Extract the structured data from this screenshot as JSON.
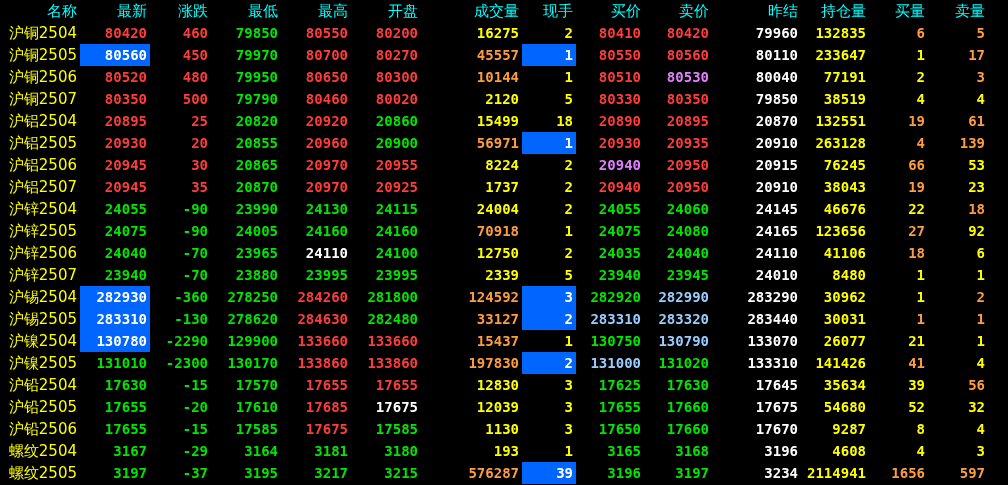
{
  "columns": [
    "名称",
    "最新",
    "涨跌",
    "最低",
    "最高",
    "开盘",
    "成交量",
    "现手",
    "买价",
    "卖价",
    "昨结",
    "持仓量",
    "买量",
    "卖量"
  ],
  "rows": [
    {
      "name": "沪铜2504",
      "cells": [
        {
          "text": "80420",
          "color": "#ff3c3c",
          "highlighted": false
        },
        {
          "text": "460",
          "color": "#ff3c3c"
        },
        {
          "text": "79850",
          "color": "#00e600"
        },
        {
          "text": "80550",
          "color": "#ff3c3c"
        },
        {
          "text": "80200",
          "color": "#ff3c3c"
        },
        {
          "text": "16275",
          "color": "#ffff00"
        },
        {
          "text": "2",
          "color": "#ffff00",
          "highlighted": false
        },
        {
          "text": "80410",
          "color": "#ff3c3c"
        },
        {
          "text": "80420",
          "color": "#ff3c3c"
        },
        {
          "text": "79960",
          "color": "#ffffff"
        },
        {
          "text": "132835",
          "color": "#ffff00"
        },
        {
          "text": "6",
          "color": "#ff9c40"
        },
        {
          "text": "5",
          "color": "#ff9c40"
        }
      ]
    },
    {
      "name": "沪铜2505",
      "cells": [
        {
          "text": "80560",
          "color": "#ffffff",
          "highlighted": true
        },
        {
          "text": "450",
          "color": "#ff3c3c"
        },
        {
          "text": "79970",
          "color": "#00e600"
        },
        {
          "text": "80700",
          "color": "#ff3c3c"
        },
        {
          "text": "80270",
          "color": "#ff3c3c"
        },
        {
          "text": "45557",
          "color": "#ff9c40"
        },
        {
          "text": "1",
          "color": "#ffffff",
          "highlighted": true
        },
        {
          "text": "80550",
          "color": "#ff3c3c"
        },
        {
          "text": "80560",
          "color": "#ff3c3c"
        },
        {
          "text": "80110",
          "color": "#ffffff"
        },
        {
          "text": "233647",
          "color": "#ffff00"
        },
        {
          "text": "1",
          "color": "#ffff00"
        },
        {
          "text": "17",
          "color": "#ff9c40"
        }
      ]
    },
    {
      "name": "沪铜2506",
      "cells": [
        {
          "text": "80520",
          "color": "#ff3c3c",
          "highlighted": false
        },
        {
          "text": "480",
          "color": "#ff3c3c"
        },
        {
          "text": "79950",
          "color": "#00e600"
        },
        {
          "text": "80650",
          "color": "#ff3c3c"
        },
        {
          "text": "80300",
          "color": "#ff3c3c"
        },
        {
          "text": "10144",
          "color": "#ff9c40"
        },
        {
          "text": "1",
          "color": "#ffff00",
          "highlighted": false
        },
        {
          "text": "80510",
          "color": "#ff3c3c"
        },
        {
          "text": "80530",
          "color": "#e080ff"
        },
        {
          "text": "80040",
          "color": "#ffffff"
        },
        {
          "text": "77191",
          "color": "#ffff00"
        },
        {
          "text": "2",
          "color": "#ffff00"
        },
        {
          "text": "3",
          "color": "#ff9c40"
        }
      ]
    },
    {
      "name": "沪铜2507",
      "cells": [
        {
          "text": "80350",
          "color": "#ff3c3c",
          "highlighted": false
        },
        {
          "text": "500",
          "color": "#ff3c3c"
        },
        {
          "text": "79790",
          "color": "#00e600"
        },
        {
          "text": "80460",
          "color": "#ff3c3c"
        },
        {
          "text": "80020",
          "color": "#ff3c3c"
        },
        {
          "text": "2120",
          "color": "#ffff00"
        },
        {
          "text": "5",
          "color": "#ffff00",
          "highlighted": false
        },
        {
          "text": "80330",
          "color": "#ff3c3c"
        },
        {
          "text": "80350",
          "color": "#ff3c3c"
        },
        {
          "text": "79850",
          "color": "#ffffff"
        },
        {
          "text": "38519",
          "color": "#ffff00"
        },
        {
          "text": "4",
          "color": "#ffff00"
        },
        {
          "text": "4",
          "color": "#ffff00"
        }
      ]
    },
    {
      "name": "沪铝2504",
      "cells": [
        {
          "text": "20895",
          "color": "#ff3c3c",
          "highlighted": false
        },
        {
          "text": "25",
          "color": "#ff3c3c"
        },
        {
          "text": "20820",
          "color": "#00e600"
        },
        {
          "text": "20920",
          "color": "#ff3c3c"
        },
        {
          "text": "20860",
          "color": "#00e600"
        },
        {
          "text": "15499",
          "color": "#ffff00"
        },
        {
          "text": "18",
          "color": "#ffff00",
          "highlighted": false
        },
        {
          "text": "20890",
          "color": "#ff3c3c"
        },
        {
          "text": "20895",
          "color": "#ff3c3c"
        },
        {
          "text": "20870",
          "color": "#ffffff"
        },
        {
          "text": "132551",
          "color": "#ffff00"
        },
        {
          "text": "19",
          "color": "#ff9c40"
        },
        {
          "text": "61",
          "color": "#ff9c40"
        }
      ]
    },
    {
      "name": "沪铝2505",
      "cells": [
        {
          "text": "20930",
          "color": "#ff3c3c",
          "highlighted": false
        },
        {
          "text": "20",
          "color": "#ff3c3c"
        },
        {
          "text": "20855",
          "color": "#00e600"
        },
        {
          "text": "20960",
          "color": "#ff3c3c"
        },
        {
          "text": "20900",
          "color": "#00e600"
        },
        {
          "text": "56971",
          "color": "#ff9c40"
        },
        {
          "text": "1",
          "color": "#ffffff",
          "highlighted": true
        },
        {
          "text": "20930",
          "color": "#ff3c3c"
        },
        {
          "text": "20935",
          "color": "#ff3c3c"
        },
        {
          "text": "20910",
          "color": "#ffffff"
        },
        {
          "text": "263128",
          "color": "#ffff00"
        },
        {
          "text": "4",
          "color": "#ff9c40"
        },
        {
          "text": "139",
          "color": "#ff9c40"
        }
      ]
    },
    {
      "name": "沪铝2506",
      "cells": [
        {
          "text": "20945",
          "color": "#ff3c3c",
          "highlighted": false
        },
        {
          "text": "30",
          "color": "#ff3c3c"
        },
        {
          "text": "20865",
          "color": "#00e600"
        },
        {
          "text": "20970",
          "color": "#ff3c3c"
        },
        {
          "text": "20955",
          "color": "#ff3c3c"
        },
        {
          "text": "8224",
          "color": "#ffff00"
        },
        {
          "text": "2",
          "color": "#ffff00",
          "highlighted": false
        },
        {
          "text": "20940",
          "color": "#e080ff"
        },
        {
          "text": "20950",
          "color": "#ff3c3c"
        },
        {
          "text": "20915",
          "color": "#ffffff"
        },
        {
          "text": "76245",
          "color": "#ffff00"
        },
        {
          "text": "66",
          "color": "#ff9c40"
        },
        {
          "text": "53",
          "color": "#ffff00"
        }
      ]
    },
    {
      "name": "沪铝2507",
      "cells": [
        {
          "text": "20945",
          "color": "#ff3c3c",
          "highlighted": false
        },
        {
          "text": "35",
          "color": "#ff3c3c"
        },
        {
          "text": "20870",
          "color": "#00e600"
        },
        {
          "text": "20970",
          "color": "#ff3c3c"
        },
        {
          "text": "20925",
          "color": "#ff3c3c"
        },
        {
          "text": "1737",
          "color": "#ffff00"
        },
        {
          "text": "2",
          "color": "#ffff00",
          "highlighted": false
        },
        {
          "text": "20940",
          "color": "#ff3c3c"
        },
        {
          "text": "20950",
          "color": "#ff3c3c"
        },
        {
          "text": "20910",
          "color": "#ffffff"
        },
        {
          "text": "38043",
          "color": "#ffff00"
        },
        {
          "text": "19",
          "color": "#ff9c40"
        },
        {
          "text": "23",
          "color": "#ffff00"
        }
      ]
    },
    {
      "name": "沪锌2504",
      "cells": [
        {
          "text": "24055",
          "color": "#00e600",
          "highlighted": false
        },
        {
          "text": "-90",
          "color": "#00e600"
        },
        {
          "text": "23990",
          "color": "#00e600"
        },
        {
          "text": "24130",
          "color": "#00e600"
        },
        {
          "text": "24115",
          "color": "#00e600"
        },
        {
          "text": "24004",
          "color": "#ffff00"
        },
        {
          "text": "2",
          "color": "#ffff00",
          "highlighted": false
        },
        {
          "text": "24055",
          "color": "#00e600"
        },
        {
          "text": "24060",
          "color": "#00e600"
        },
        {
          "text": "24145",
          "color": "#ffffff"
        },
        {
          "text": "46676",
          "color": "#ffff00"
        },
        {
          "text": "22",
          "color": "#ffff00"
        },
        {
          "text": "18",
          "color": "#ff9c40"
        }
      ]
    },
    {
      "name": "沪锌2505",
      "cells": [
        {
          "text": "24075",
          "color": "#00e600",
          "highlighted": false
        },
        {
          "text": "-90",
          "color": "#00e600"
        },
        {
          "text": "24005",
          "color": "#00e600"
        },
        {
          "text": "24160",
          "color": "#00e600"
        },
        {
          "text": "24160",
          "color": "#00e600"
        },
        {
          "text": "70918",
          "color": "#ff9c40"
        },
        {
          "text": "1",
          "color": "#ffff00",
          "highlighted": false
        },
        {
          "text": "24075",
          "color": "#00e600"
        },
        {
          "text": "24080",
          "color": "#00e600"
        },
        {
          "text": "24165",
          "color": "#ffffff"
        },
        {
          "text": "123656",
          "color": "#ffff00"
        },
        {
          "text": "27",
          "color": "#ff9c40"
        },
        {
          "text": "92",
          "color": "#ffff00"
        }
      ]
    },
    {
      "name": "沪锌2506",
      "cells": [
        {
          "text": "24040",
          "color": "#00e600",
          "highlighted": false
        },
        {
          "text": "-70",
          "color": "#00e600"
        },
        {
          "text": "23965",
          "color": "#00e600"
        },
        {
          "text": "24110",
          "color": "#ffffff"
        },
        {
          "text": "24100",
          "color": "#00e600"
        },
        {
          "text": "12750",
          "color": "#ffff00"
        },
        {
          "text": "2",
          "color": "#ffff00",
          "highlighted": false
        },
        {
          "text": "24035",
          "color": "#00e600"
        },
        {
          "text": "24040",
          "color": "#00e600"
        },
        {
          "text": "24110",
          "color": "#ffffff"
        },
        {
          "text": "41106",
          "color": "#ffff00"
        },
        {
          "text": "18",
          "color": "#ff9c40"
        },
        {
          "text": "6",
          "color": "#ffff00"
        }
      ]
    },
    {
      "name": "沪锌2507",
      "cells": [
        {
          "text": "23940",
          "color": "#00e600",
          "highlighted": false
        },
        {
          "text": "-70",
          "color": "#00e600"
        },
        {
          "text": "23880",
          "color": "#00e600"
        },
        {
          "text": "23995",
          "color": "#00e600"
        },
        {
          "text": "23995",
          "color": "#00e600"
        },
        {
          "text": "2339",
          "color": "#ffff00"
        },
        {
          "text": "5",
          "color": "#ffff00",
          "highlighted": false
        },
        {
          "text": "23940",
          "color": "#00e600"
        },
        {
          "text": "23945",
          "color": "#00e600"
        },
        {
          "text": "24010",
          "color": "#ffffff"
        },
        {
          "text": "8480",
          "color": "#ffff00"
        },
        {
          "text": "1",
          "color": "#ffff00"
        },
        {
          "text": "1",
          "color": "#ffff00"
        }
      ]
    },
    {
      "name": "沪锡2504",
      "cells": [
        {
          "text": "282930",
          "color": "#ffffff",
          "highlighted": true
        },
        {
          "text": "-360",
          "color": "#00e600"
        },
        {
          "text": "278250",
          "color": "#00e600"
        },
        {
          "text": "284260",
          "color": "#ff3c3c"
        },
        {
          "text": "281800",
          "color": "#00e600"
        },
        {
          "text": "124592",
          "color": "#ff9c40"
        },
        {
          "text": "3",
          "color": "#ffffff",
          "highlighted": true
        },
        {
          "text": "282920",
          "color": "#00e600"
        },
        {
          "text": "282990",
          "color": "#99ccff"
        },
        {
          "text": "283290",
          "color": "#ffffff"
        },
        {
          "text": "30962",
          "color": "#ffff00"
        },
        {
          "text": "1",
          "color": "#ffff00"
        },
        {
          "text": "2",
          "color": "#ff9c40"
        }
      ]
    },
    {
      "name": "沪锡2505",
      "cells": [
        {
          "text": "283310",
          "color": "#ffffff",
          "highlighted": true
        },
        {
          "text": "-130",
          "color": "#00e600"
        },
        {
          "text": "278620",
          "color": "#00e600"
        },
        {
          "text": "284630",
          "color": "#ff3c3c"
        },
        {
          "text": "282480",
          "color": "#00e600"
        },
        {
          "text": "33127",
          "color": "#ff9c40"
        },
        {
          "text": "2",
          "color": "#ffffff",
          "highlighted": true
        },
        {
          "text": "283310",
          "color": "#99ccff"
        },
        {
          "text": "283320",
          "color": "#99ccff"
        },
        {
          "text": "283440",
          "color": "#ffffff"
        },
        {
          "text": "30031",
          "color": "#ffff00"
        },
        {
          "text": "1",
          "color": "#ff9c40"
        },
        {
          "text": "1",
          "color": "#ff9c40"
        }
      ]
    },
    {
      "name": "沪镍2504",
      "cells": [
        {
          "text": "130780",
          "color": "#ffffff",
          "highlighted": true
        },
        {
          "text": "-2290",
          "color": "#00e600"
        },
        {
          "text": "129900",
          "color": "#00e600"
        },
        {
          "text": "133660",
          "color": "#ff3c3c"
        },
        {
          "text": "133660",
          "color": "#ff3c3c"
        },
        {
          "text": "15437",
          "color": "#ff9c40"
        },
        {
          "text": "1",
          "color": "#ffff00",
          "highlighted": false
        },
        {
          "text": "130750",
          "color": "#00e600"
        },
        {
          "text": "130790",
          "color": "#99ccff"
        },
        {
          "text": "133070",
          "color": "#ffffff"
        },
        {
          "text": "26077",
          "color": "#ffff00"
        },
        {
          "text": "21",
          "color": "#ffff00"
        },
        {
          "text": "1",
          "color": "#ffff00"
        }
      ]
    },
    {
      "name": "沪镍2505",
      "cells": [
        {
          "text": "131010",
          "color": "#00e600",
          "highlighted": false
        },
        {
          "text": "-2300",
          "color": "#00e600"
        },
        {
          "text": "130170",
          "color": "#00e600"
        },
        {
          "text": "133860",
          "color": "#ff3c3c"
        },
        {
          "text": "133860",
          "color": "#ff3c3c"
        },
        {
          "text": "197830",
          "color": "#ff9c40"
        },
        {
          "text": "2",
          "color": "#ffffff",
          "highlighted": true
        },
        {
          "text": "131000",
          "color": "#99ccff"
        },
        {
          "text": "131020",
          "color": "#00e600"
        },
        {
          "text": "133310",
          "color": "#ffffff"
        },
        {
          "text": "141426",
          "color": "#ffff00"
        },
        {
          "text": "41",
          "color": "#ff9c40"
        },
        {
          "text": "4",
          "color": "#ffff00"
        }
      ]
    },
    {
      "name": "沪铅2504",
      "cells": [
        {
          "text": "17630",
          "color": "#00e600",
          "highlighted": false
        },
        {
          "text": "-15",
          "color": "#00e600"
        },
        {
          "text": "17570",
          "color": "#00e600"
        },
        {
          "text": "17655",
          "color": "#ff3c3c"
        },
        {
          "text": "17655",
          "color": "#ff3c3c"
        },
        {
          "text": "12830",
          "color": "#ffff00"
        },
        {
          "text": "3",
          "color": "#ffff00",
          "highlighted": false
        },
        {
          "text": "17625",
          "color": "#00e600"
        },
        {
          "text": "17630",
          "color": "#00e600"
        },
        {
          "text": "17645",
          "color": "#ffffff"
        },
        {
          "text": "35634",
          "color": "#ffff00"
        },
        {
          "text": "39",
          "color": "#ffff00"
        },
        {
          "text": "56",
          "color": "#ff9c40"
        }
      ]
    },
    {
      "name": "沪铅2505",
      "cells": [
        {
          "text": "17655",
          "color": "#00e600",
          "highlighted": false
        },
        {
          "text": "-20",
          "color": "#00e600"
        },
        {
          "text": "17610",
          "color": "#00e600"
        },
        {
          "text": "17685",
          "color": "#ff3c3c"
        },
        {
          "text": "17675",
          "color": "#ffffff"
        },
        {
          "text": "12039",
          "color": "#ffff00"
        },
        {
          "text": "3",
          "color": "#ffff00",
          "highlighted": false
        },
        {
          "text": "17655",
          "color": "#00e600"
        },
        {
          "text": "17660",
          "color": "#00e600"
        },
        {
          "text": "17675",
          "color": "#ffffff"
        },
        {
          "text": "54680",
          "color": "#ffff00"
        },
        {
          "text": "52",
          "color": "#ffff00"
        },
        {
          "text": "32",
          "color": "#ffff00"
        }
      ]
    },
    {
      "name": "沪铅2506",
      "cells": [
        {
          "text": "17655",
          "color": "#00e600",
          "highlighted": false
        },
        {
          "text": "-15",
          "color": "#00e600"
        },
        {
          "text": "17585",
          "color": "#00e600"
        },
        {
          "text": "17675",
          "color": "#ff3c3c"
        },
        {
          "text": "17585",
          "color": "#00e600"
        },
        {
          "text": "1130",
          "color": "#ffff00"
        },
        {
          "text": "3",
          "color": "#ffff00",
          "highlighted": false
        },
        {
          "text": "17650",
          "color": "#00e600"
        },
        {
          "text": "17660",
          "color": "#00e600"
        },
        {
          "text": "17670",
          "color": "#ffffff"
        },
        {
          "text": "9287",
          "color": "#ffff00"
        },
        {
          "text": "8",
          "color": "#ffff00"
        },
        {
          "text": "4",
          "color": "#ffff00"
        }
      ]
    },
    {
      "name": "螺纹2504",
      "cells": [
        {
          "text": "3167",
          "color": "#00e600",
          "highlighted": false
        },
        {
          "text": "-29",
          "color": "#00e600"
        },
        {
          "text": "3164",
          "color": "#00e600"
        },
        {
          "text": "3181",
          "color": "#00e600"
        },
        {
          "text": "3180",
          "color": "#00e600"
        },
        {
          "text": "193",
          "color": "#ffff00"
        },
        {
          "text": "1",
          "color": "#ffff00",
          "highlighted": false
        },
        {
          "text": "3165",
          "color": "#00e600"
        },
        {
          "text": "3168",
          "color": "#00e600"
        },
        {
          "text": "3196",
          "color": "#ffffff"
        },
        {
          "text": "4608",
          "color": "#ffff00"
        },
        {
          "text": "4",
          "color": "#ffff00"
        },
        {
          "text": "3",
          "color": "#ffff00"
        }
      ]
    },
    {
      "name": "螺纹2505",
      "cells": [
        {
          "text": "3197",
          "color": "#00e600",
          "highlighted": false
        },
        {
          "text": "-37",
          "color": "#00e600"
        },
        {
          "text": "3195",
          "color": "#00e600"
        },
        {
          "text": "3217",
          "color": "#00e600"
        },
        {
          "text": "3215",
          "color": "#00e600"
        },
        {
          "text": "576287",
          "color": "#ff9c40"
        },
        {
          "text": "39",
          "color": "#ffffff",
          "highlighted": true
        },
        {
          "text": "3196",
          "color": "#00e600"
        },
        {
          "text": "3197",
          "color": "#00e600"
        },
        {
          "text": "3234",
          "color": "#ffffff"
        },
        {
          "text": "2114941",
          "color": "#ffff00"
        },
        {
          "text": "1656",
          "color": "#ff9c40"
        },
        {
          "text": "597",
          "color": "#ff9c40"
        }
      ]
    }
  ]
}
